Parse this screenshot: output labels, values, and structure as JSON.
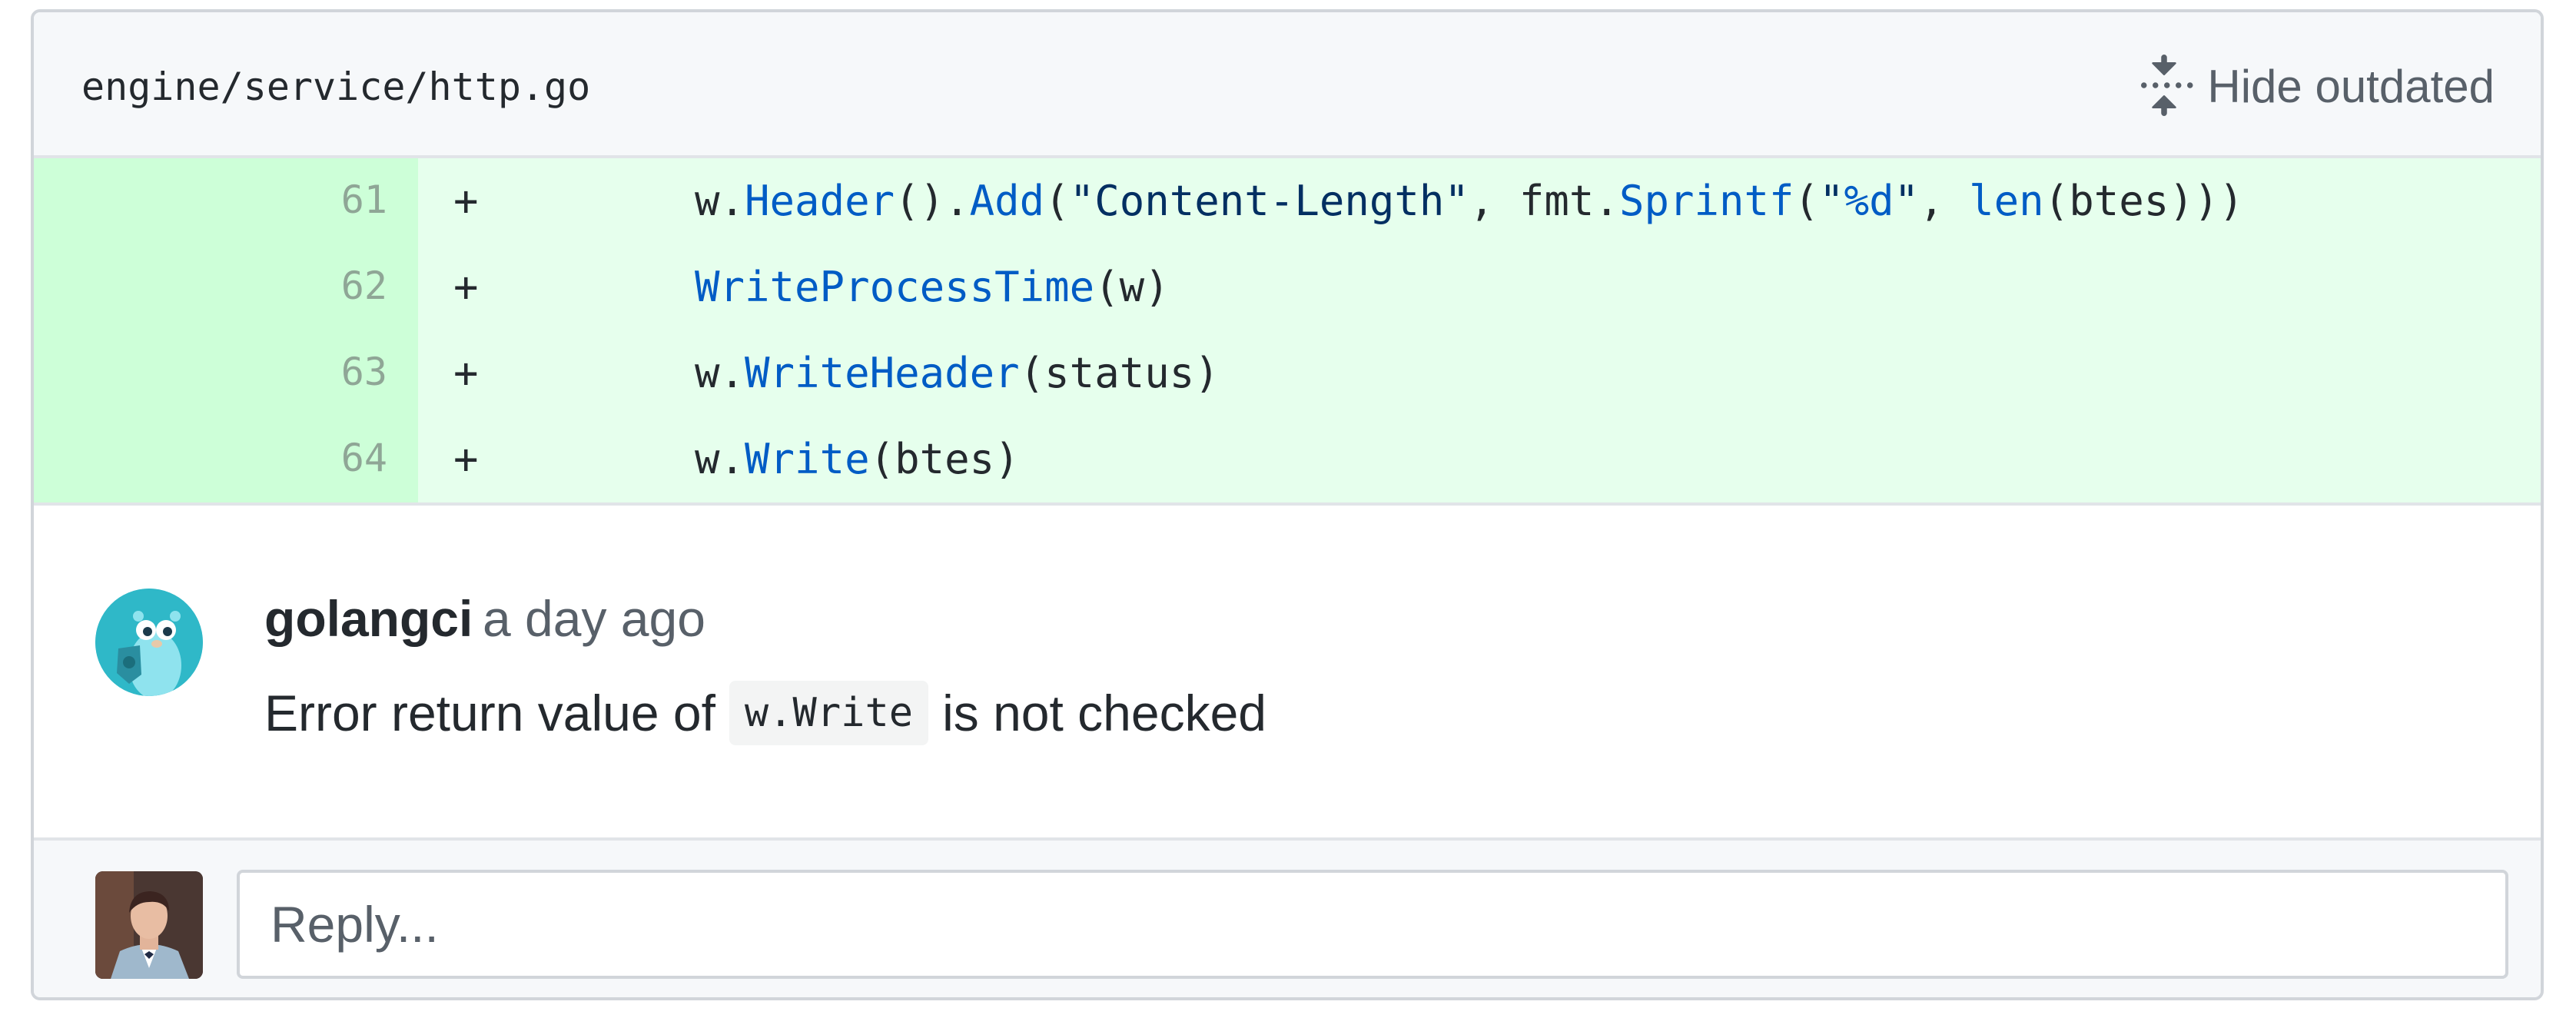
{
  "file": {
    "path": "engine/service/http.go",
    "hide_outdated_label": "Hide outdated"
  },
  "diff": {
    "lines": [
      {
        "number": "61",
        "marker": "+",
        "code": "w.Header().Add(\"Content-Length\", fmt.Sprintf(\"%d\", len(btes)))"
      },
      {
        "number": "62",
        "marker": "+",
        "code": "WriteProcessTime(w)"
      },
      {
        "number": "63",
        "marker": "+",
        "code": "w.WriteHeader(status)"
      },
      {
        "number": "64",
        "marker": "+",
        "code": "w.Write(btes)"
      }
    ]
  },
  "comment": {
    "author": "golangci",
    "time": "a day ago",
    "text_before": "Error return value of",
    "code": "w.Write",
    "text_after": "is not checked"
  },
  "reply": {
    "placeholder": "Reply..."
  },
  "colors": {
    "added_line_bg": "#e6ffed",
    "added_number_bg": "#cdffd8",
    "function_blue": "#005cc5",
    "string_navy": "#032f62"
  },
  "icons": {
    "hide_outdated": "fold-icon",
    "bot_avatar": "gopher-avatar",
    "user_avatar": "user-photo-avatar"
  }
}
